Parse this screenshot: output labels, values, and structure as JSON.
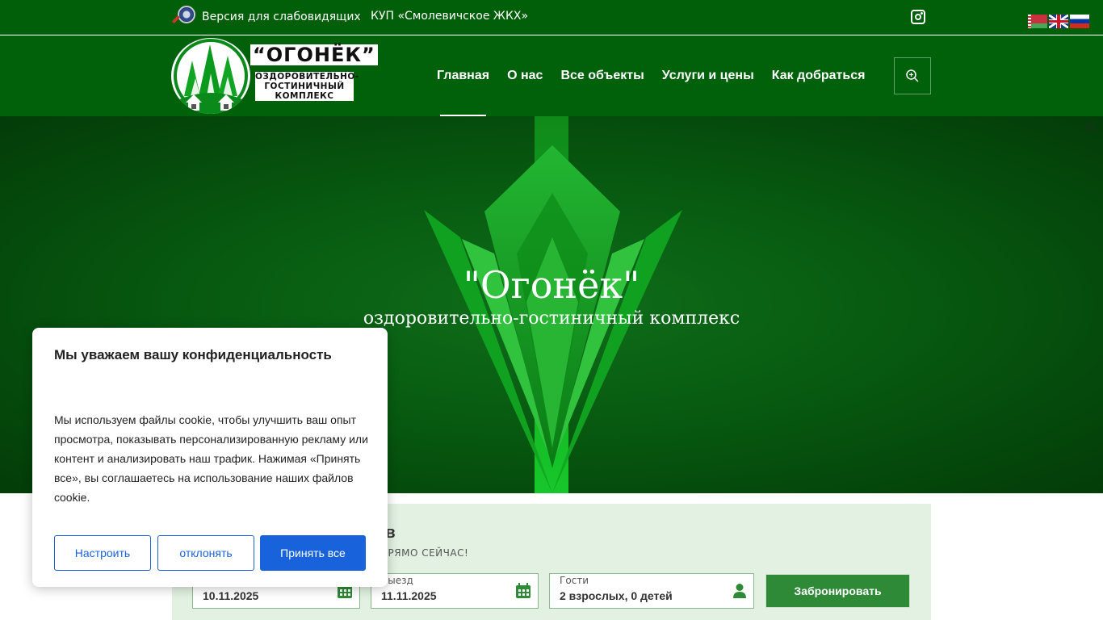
{
  "topbar": {
    "vision_label": "Версия для слабовидящих",
    "org_name": "КУП «Смолевичское ЖКХ»",
    "languages": [
      "be",
      "en",
      "ru"
    ]
  },
  "header": {
    "logo": {
      "brand": "“ОГОНЁК”",
      "subtitle": "ОЗДОРОВИТЕЛЬНО-ГОСТИНИЧНЫЙ КОМПЛЕКС"
    },
    "nav": [
      {
        "label": "Главная",
        "active": true
      },
      {
        "label": "О нас"
      },
      {
        "label": "Все объекты"
      },
      {
        "label": "Услуги и цены"
      },
      {
        "label": "Как добраться"
      }
    ]
  },
  "hero": {
    "title": "\"Огонёк\"",
    "subtitle": "оздоровительно-гостиничный комплекс"
  },
  "booking": {
    "title_fragment": "ров",
    "subtitle_fragment": "ПРЯМО СЕЙЧАС!",
    "checkin": {
      "label": "",
      "value": "10.11.2025"
    },
    "checkout": {
      "label": "Выезд",
      "value": "11.11.2025"
    },
    "guests": {
      "label": "Гости",
      "value": "2 взрослых, 0 детей"
    },
    "button": "Забронировать"
  },
  "cookie": {
    "title": "Мы уважаем вашу конфиденциальность",
    "body": "Мы используем файлы cookie, чтобы улучшить ваш опыт просмотра, показывать персонализированную рекламу или контент и анализировать наш трафик. Нажимая «Принять все», вы соглашаетесь на использование наших файлов cookie.",
    "customize": "Настроить",
    "reject": "отклонять",
    "accept": "Принять все"
  },
  "colors": {
    "header_green": "#00610b",
    "topbar_green": "#005f08",
    "cookie_blue": "#1863dc",
    "book_button": "#2f8a37"
  },
  "icons": [
    "magnifier-eye-icon",
    "instagram-icon",
    "search-icon",
    "calendar-icon",
    "user-icon"
  ]
}
